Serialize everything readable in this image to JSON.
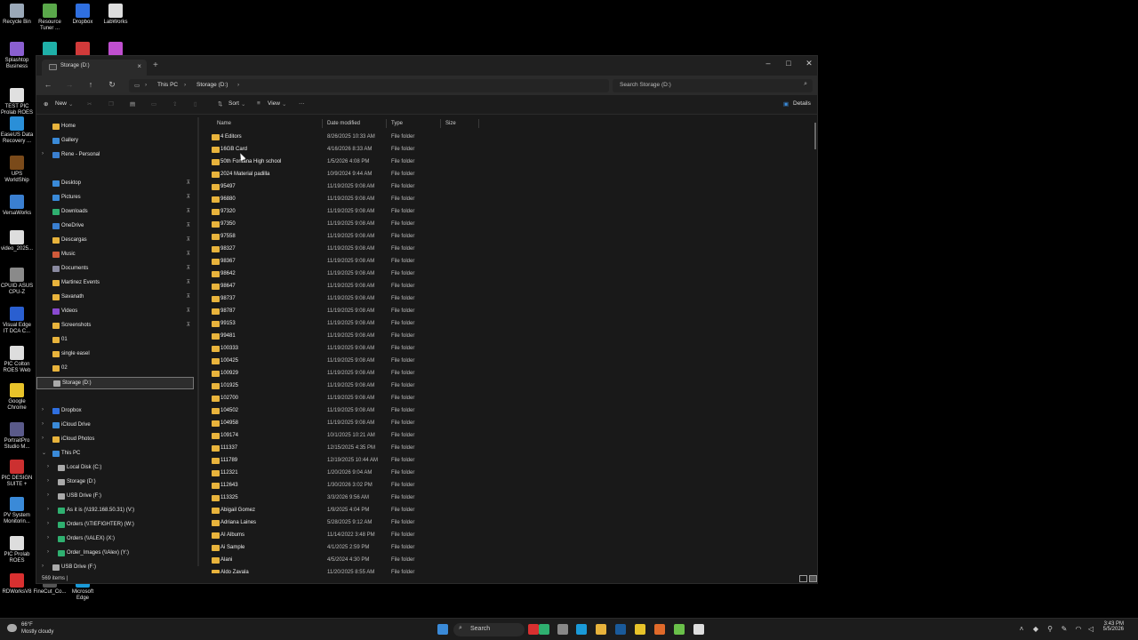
{
  "desktop": {
    "icons": [
      {
        "label": "Recycle Bin",
        "color": "#9aa8b8"
      },
      {
        "label": "Resource Tuner ...",
        "color": "#5aa84a"
      },
      {
        "label": "Dropbox",
        "color": "#2f6fe0"
      },
      {
        "label": "LabWorks",
        "color": "#dddddd"
      },
      {
        "label": "Splashtop Business",
        "color": "#8a5fd0"
      },
      {
        "label": "",
        "color": "#1fb0a8"
      },
      {
        "label": "",
        "color": "#d13a3a"
      },
      {
        "label": "",
        "color": "#c04fd0"
      },
      {
        "label": "TEST PIC Prolab ROES",
        "color": "#e0e0e0"
      },
      {
        "label": "EaseUS Data Recovery ...",
        "color": "#2a8fd8"
      },
      {
        "label": "UPS WorldShip",
        "color": "#7a4a1a"
      },
      {
        "label": "VersaWorks",
        "color": "#3a7fd0"
      },
      {
        "label": "video_2025...",
        "color": "#dddddd"
      },
      {
        "label": "CPUID ASUS CPU-Z",
        "color": "#8a8a8a"
      },
      {
        "label": "Visual Edge IT DCA C...",
        "color": "#2a5fd0"
      },
      {
        "label": "PIC Colton ROES Web",
        "color": "#dddddd"
      },
      {
        "label": "Google Chrome",
        "color": "#e8c32a"
      },
      {
        "label": "PortraitPro Studio M...",
        "color": "#5a5a8a"
      },
      {
        "label": "PIC DESIGN SUITE +",
        "color": "#cc3030"
      },
      {
        "label": "PV System Monitorin...",
        "color": "#3a8ad8"
      },
      {
        "label": "PIC Prolab ROES",
        "color": "#dddddd"
      },
      {
        "label": "RDWorksV8",
        "color": "#d83030"
      },
      {
        "label": "FineCut_Co...",
        "color": "#555555"
      },
      {
        "label": "Microsoft Edge",
        "color": "#1a9ad8"
      }
    ]
  },
  "window": {
    "tab_title": "Storage (D:)",
    "tab_close": "×",
    "new_tab": "+",
    "controls": {
      "minimize": "–",
      "maximize": "□",
      "close": "✕"
    },
    "nav": {
      "back": "←",
      "forward": "→",
      "up": "↑",
      "refresh": "↻"
    },
    "breadcrumb": [
      "This PC",
      "Storage (D:)"
    ],
    "breadcrumb_sep": "›",
    "search_placeholder": "Search Storage (D:)",
    "search_icon": "⌕",
    "toolbar": {
      "new_label": "New",
      "sort_label": "Sort",
      "view_label": "View",
      "more_label": "···",
      "details_label": "Details"
    }
  },
  "sidebar": {
    "items": [
      {
        "label": "Home",
        "icon": "home-icon",
        "color": "#e8b33c",
        "pin": false
      },
      {
        "label": "Gallery",
        "icon": "gallery-icon",
        "color": "#3a8ad8",
        "pin": false
      },
      {
        "label": "Rene - Personal",
        "icon": "onedrive-icon",
        "color": "#3a7fd0",
        "pin": false,
        "chevron": true
      },
      {
        "label": "Desktop",
        "icon": "desktop-icon",
        "color": "#3a8ad8",
        "pin": true
      },
      {
        "label": "Pictures",
        "icon": "pictures-icon",
        "color": "#3a8ad8",
        "pin": true
      },
      {
        "label": "Downloads",
        "icon": "downloads-icon",
        "color": "#2fb070",
        "pin": true
      },
      {
        "label": "OneDrive",
        "icon": "onedrive-icon",
        "color": "#3a7fd0",
        "pin": true
      },
      {
        "label": "Descargas",
        "icon": "folder-icon",
        "color": "#e8b33c",
        "pin": true
      },
      {
        "label": "Music",
        "icon": "music-icon",
        "color": "#d05a3a",
        "pin": true
      },
      {
        "label": "Documents",
        "icon": "documents-icon",
        "color": "#8a8aa0",
        "pin": true
      },
      {
        "label": "Martinez Events",
        "icon": "folder-icon",
        "color": "#e8b33c",
        "pin": true
      },
      {
        "label": "Savanath",
        "icon": "folder-icon",
        "color": "#e8b33c",
        "pin": true
      },
      {
        "label": "Videos",
        "icon": "videos-icon",
        "color": "#8a4ad0",
        "pin": true
      },
      {
        "label": "Screenshots",
        "icon": "folder-icon",
        "color": "#e8b33c",
        "pin": true
      },
      {
        "label": "01",
        "icon": "folder-icon",
        "color": "#e8b33c",
        "pin": false
      },
      {
        "label": "single easel",
        "icon": "folder-icon",
        "color": "#e8b33c",
        "pin": false
      },
      {
        "label": "02",
        "icon": "folder-icon",
        "color": "#e8b33c",
        "pin": false
      },
      {
        "label": "Storage (D:)",
        "icon": "drive-icon",
        "color": "#aaaaaa",
        "pin": false,
        "selected": true
      },
      {
        "label": "Dropbox",
        "icon": "dropbox-icon",
        "color": "#2f6fe0",
        "pin": false,
        "chevron": true
      },
      {
        "label": "iCloud Drive",
        "icon": "icloud-icon",
        "color": "#3a8ad8",
        "pin": false,
        "chevron": true
      },
      {
        "label": "iCloud Photos",
        "icon": "icloud-photos-icon",
        "color": "#e8b33c",
        "pin": false,
        "chevron": true
      },
      {
        "label": "This PC",
        "icon": "pc-icon",
        "color": "#3a8ad8",
        "pin": false,
        "chevron": true,
        "expanded": true
      },
      {
        "label": "Local Disk (C:)",
        "icon": "drive-icon",
        "color": "#aaaaaa",
        "pin": false,
        "chevron": true,
        "indent": 1
      },
      {
        "label": "Storage (D:)",
        "icon": "drive-icon",
        "color": "#aaaaaa",
        "pin": false,
        "chevron": true,
        "indent": 1
      },
      {
        "label": "USB Drive (F:)",
        "icon": "drive-icon",
        "color": "#aaaaaa",
        "pin": false,
        "chevron": true,
        "indent": 1
      },
      {
        "label": "As it is (\\\\192.168.50.31) (V:)",
        "icon": "network-drive-icon",
        "color": "#2fb070",
        "pin": false,
        "chevron": true,
        "indent": 1
      },
      {
        "label": "Orders (\\\\TIEFIGHTER) (W:)",
        "icon": "network-drive-icon",
        "color": "#2fb070",
        "pin": false,
        "chevron": true,
        "indent": 1
      },
      {
        "label": "Orders (\\\\ALEX) (X:)",
        "icon": "network-drive-icon",
        "color": "#2fb070",
        "pin": false,
        "chevron": true,
        "indent": 1
      },
      {
        "label": "Order_Images (\\\\Alex) (Y:)",
        "icon": "network-drive-icon",
        "color": "#2fb070",
        "pin": false,
        "chevron": true,
        "indent": 1
      },
      {
        "label": "USB Drive (F:)",
        "icon": "drive-icon",
        "color": "#aaaaaa",
        "pin": false,
        "chevron": true
      }
    ]
  },
  "filelist": {
    "columns": [
      "Name",
      "Date modified",
      "Type",
      "Size"
    ],
    "rows": [
      {
        "name": "4 Editors",
        "date": "8/26/2025 10:33 AM",
        "type": "File folder"
      },
      {
        "name": "16GB Card",
        "date": "4/16/2026 8:33 AM",
        "type": "File folder"
      },
      {
        "name": "50th Fontana High school",
        "date": "1/5/2026 4:08 PM",
        "type": "File folder"
      },
      {
        "name": "2024 Material padilla",
        "date": "10/9/2024 9:44 AM",
        "type": "File folder"
      },
      {
        "name": "95497",
        "date": "11/19/2025 9:08 AM",
        "type": "File folder"
      },
      {
        "name": "96880",
        "date": "11/19/2025 9:08 AM",
        "type": "File folder"
      },
      {
        "name": "97320",
        "date": "11/19/2025 9:08 AM",
        "type": "File folder"
      },
      {
        "name": "97350",
        "date": "11/19/2025 9:08 AM",
        "type": "File folder"
      },
      {
        "name": "97558",
        "date": "11/19/2025 9:08 AM",
        "type": "File folder"
      },
      {
        "name": "98327",
        "date": "11/19/2025 9:08 AM",
        "type": "File folder"
      },
      {
        "name": "98367",
        "date": "11/19/2025 9:08 AM",
        "type": "File folder"
      },
      {
        "name": "98642",
        "date": "11/19/2025 9:08 AM",
        "type": "File folder"
      },
      {
        "name": "98647",
        "date": "11/19/2025 9:08 AM",
        "type": "File folder"
      },
      {
        "name": "98737",
        "date": "11/19/2025 9:08 AM",
        "type": "File folder"
      },
      {
        "name": "98787",
        "date": "11/19/2025 9:08 AM",
        "type": "File folder"
      },
      {
        "name": "99153",
        "date": "11/19/2025 9:08 AM",
        "type": "File folder"
      },
      {
        "name": "99481",
        "date": "11/19/2025 9:08 AM",
        "type": "File folder"
      },
      {
        "name": "100333",
        "date": "11/19/2025 9:08 AM",
        "type": "File folder"
      },
      {
        "name": "100425",
        "date": "11/19/2025 9:08 AM",
        "type": "File folder"
      },
      {
        "name": "100929",
        "date": "11/19/2025 9:08 AM",
        "type": "File folder"
      },
      {
        "name": "101925",
        "date": "11/19/2025 9:08 AM",
        "type": "File folder"
      },
      {
        "name": "102700",
        "date": "11/19/2025 9:08 AM",
        "type": "File folder"
      },
      {
        "name": "104502",
        "date": "11/19/2025 9:08 AM",
        "type": "File folder"
      },
      {
        "name": "104958",
        "date": "11/19/2025 9:08 AM",
        "type": "File folder"
      },
      {
        "name": "109174",
        "date": "10/1/2025 10:21 AM",
        "type": "File folder"
      },
      {
        "name": "111337",
        "date": "12/15/2025 4:35 PM",
        "type": "File folder"
      },
      {
        "name": "111789",
        "date": "12/19/2025 10:44 AM",
        "type": "File folder"
      },
      {
        "name": "112321",
        "date": "1/20/2026 9:04 AM",
        "type": "File folder"
      },
      {
        "name": "112643",
        "date": "1/30/2026 3:02 PM",
        "type": "File folder"
      },
      {
        "name": "113325",
        "date": "3/3/2026 9:56 AM",
        "type": "File folder"
      },
      {
        "name": "Abigail Gomez",
        "date": "1/9/2025 4:04 PM",
        "type": "File folder"
      },
      {
        "name": "Adriana Laines",
        "date": "5/28/2025 9:12 AM",
        "type": "File folder"
      },
      {
        "name": "AI Albums",
        "date": "11/14/2022 3:48 PM",
        "type": "File folder"
      },
      {
        "name": "Ai Sample",
        "date": "4/1/2025 2:59 PM",
        "type": "File folder"
      },
      {
        "name": "Alani",
        "date": "4/5/2024 4:30 PM",
        "type": "File folder"
      },
      {
        "name": "Aldo Zavala",
        "date": "11/20/2025 8:55 AM",
        "type": "File folder"
      }
    ],
    "status": "569 items  |"
  },
  "taskbar": {
    "weather_temp": "66°F",
    "weather_cond": "Mostly cloudy",
    "search_label": "Search",
    "search_icon": "⌕",
    "pinned": [
      {
        "name": "start-icon",
        "color": "#3a8ad8"
      },
      {
        "name": "app-red-icon",
        "color": "#d83030"
      },
      {
        "name": "app-green-icon",
        "color": "#2fb070"
      },
      {
        "name": "task-view-icon",
        "color": "#888888"
      },
      {
        "name": "edge-icon",
        "color": "#1a9ad8"
      },
      {
        "name": "file-explorer-icon",
        "color": "#e8b33c"
      },
      {
        "name": "photoshop-icon",
        "color": "#1a5a9a"
      },
      {
        "name": "chrome-icon",
        "color": "#e8c32a"
      },
      {
        "name": "app-orange-icon",
        "color": "#e06a2a"
      },
      {
        "name": "app-lime-icon",
        "color": "#6ac04a"
      },
      {
        "name": "app-white-icon",
        "color": "#dddddd"
      }
    ],
    "time": "3:43 PM",
    "date": "5/5/2026"
  }
}
